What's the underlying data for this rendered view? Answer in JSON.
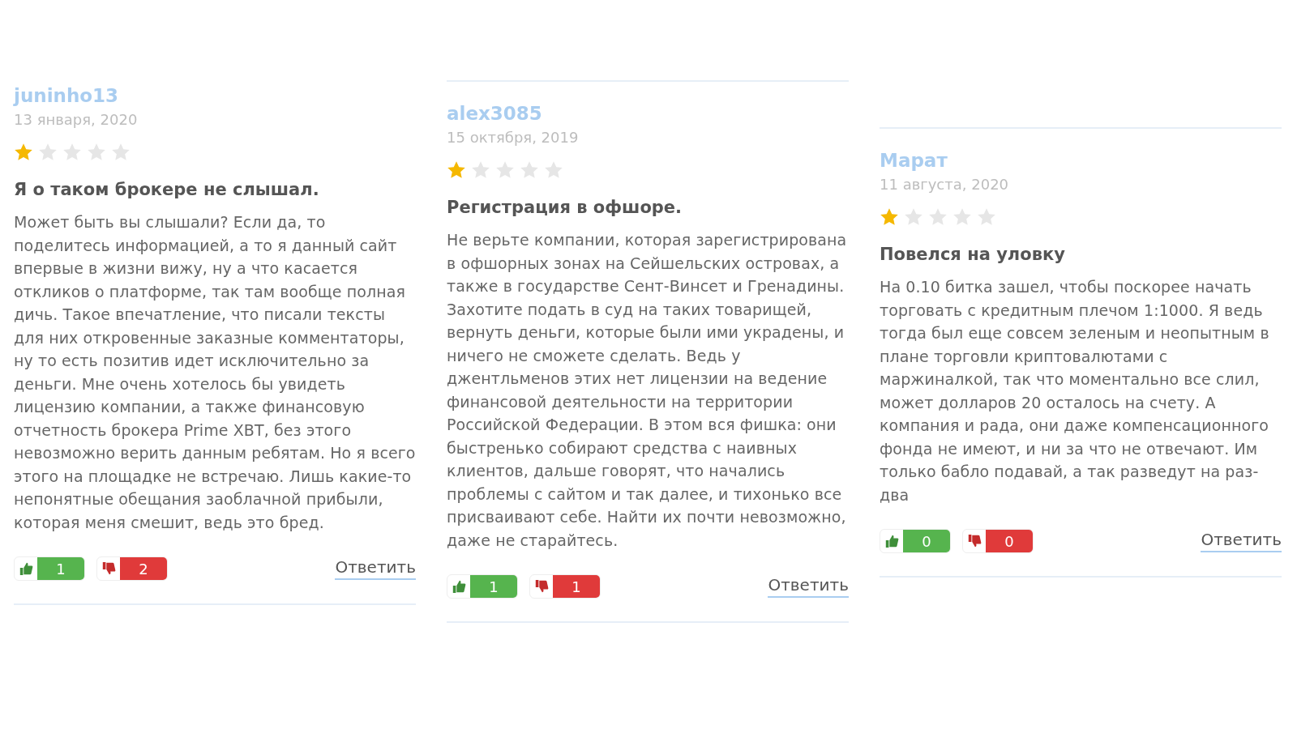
{
  "reviews": [
    {
      "author": "juninho13",
      "date": "13 января, 2020",
      "stars": 1,
      "title": "Я о таком брокере не слышал.",
      "text": "Может быть вы слышали? Если да, то поделитесь информацией, а то я данный сайт впервые в жизни вижу, ну а что касается откликов о платформе, так там вообще полная дичь. Такое впечатление, что писали тексты для них откровенные заказные комментаторы, ну то есть позитив идет исключительно за деньги. Мне очень хотелось бы увидеть лицензию компании, а также финансовую отчетность брокера Prime XBT, без этого невозможно верить данным ребятам. Но я всего этого на площадке не встречаю. Лишь какие-то непонятные обещания заоблачной прибыли, которая меня смешит, ведь это бред.",
      "likes": "1",
      "dislikes": "2",
      "reply": "Ответить"
    },
    {
      "author": "alex3085",
      "date": "15 октября, 2019",
      "stars": 1,
      "title": "Регистрация в офшоре.",
      "text": "Не верьте компании, которая зарегистрирована в офшорных зонах на Сейшельских островах, а также в государстве Сент-Винсет и Гренадины. Захотите подать в суд на таких товарищей, вернуть деньги, которые были ими украдены, и ничего не сможете сделать. Ведь у джентльменов этих нет лицензии на ведение финансовой деятельности на территории Российской Федерации. В этом вся фишка: они быстренько собирают средства с наивных клиентов, дальше говорят, что начались проблемы с сайтом и так далее, и тихонько все присваивают себе. Найти их почти невозможно, даже не старайтесь.",
      "likes": "1",
      "dislikes": "1",
      "reply": "Ответить"
    },
    {
      "author": "Марат",
      "date": "11 августа, 2020",
      "stars": 1,
      "title": "Повелся на уловку",
      "text": "На 0.10 битка зашел, чтобы поскорее начать торговать с кредитным плечом 1:1000. Я ведь тогда был еще совсем зеленым и неопытным в плане торговли криптовалютами с маржиналкой, так что моментально все слил, может долларов 20 осталось на счету. А компания и рада, они даже компенсационного фонда не имеют, и ни за что не отвечают. Им только бабло подавай, а так разведут на раз-два",
      "likes": "0",
      "dislikes": "0",
      "reply": "Ответить"
    }
  ]
}
